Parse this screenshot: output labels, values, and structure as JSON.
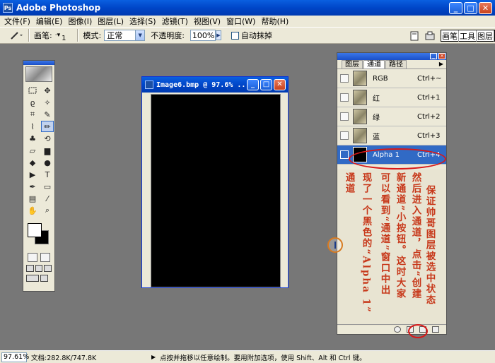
{
  "app": {
    "title": "Adobe Photoshop",
    "icon": "Ps"
  },
  "window_buttons": {
    "minimize": "_",
    "maximize": "□",
    "close": "✕"
  },
  "menu": [
    "文件(F)",
    "编辑(E)",
    "图像(I)",
    "图层(L)",
    "选择(S)",
    "滤镜(T)",
    "视图(V)",
    "窗口(W)",
    "帮助(H)"
  ],
  "options": {
    "brush_label": "画笔:",
    "brush_size": "1",
    "mode_label": "模式:",
    "mode_value": "正常",
    "opacity_label": "不透明度:",
    "opacity_value": "100%",
    "auto_erase_label": "自动抹掉",
    "palette_well": [
      "画笔",
      "工具",
      "图层"
    ]
  },
  "document": {
    "title": "Image6.bmp @ 97.6% ..."
  },
  "channels_panel": {
    "tabs": [
      "图层",
      "通道",
      "路径"
    ],
    "active_tab": 1,
    "menu_arrow": "▶",
    "channels": [
      {
        "name": "RGB",
        "shortcut": "Ctrl+~"
      },
      {
        "name": "红",
        "shortcut": "Ctrl+1"
      },
      {
        "name": "绿",
        "shortcut": "Ctrl+2"
      },
      {
        "name": "蓝",
        "shortcut": "Ctrl+3"
      },
      {
        "name": "Alpha 1",
        "shortcut": "Ctrl+4"
      }
    ],
    "selected_channel": 4
  },
  "annotation": {
    "columns": [
      "保证帅哥图层被选中状态",
      "然后进入通道，点击“创建",
      "新通道”小按钮。这时大家",
      "可以看到“通道”窗口中出",
      "现了一个黑色的“Alpha 1”",
      "通道"
    ],
    "color": "#c7381a"
  },
  "status": {
    "zoom": "97.61%",
    "doc_info": "文档:282.8K/747.8K",
    "arrow": "▶",
    "message": "点按并拖移以任意绘制。要用附加选项，使用 Shift、Alt 和 Ctrl 键。"
  }
}
